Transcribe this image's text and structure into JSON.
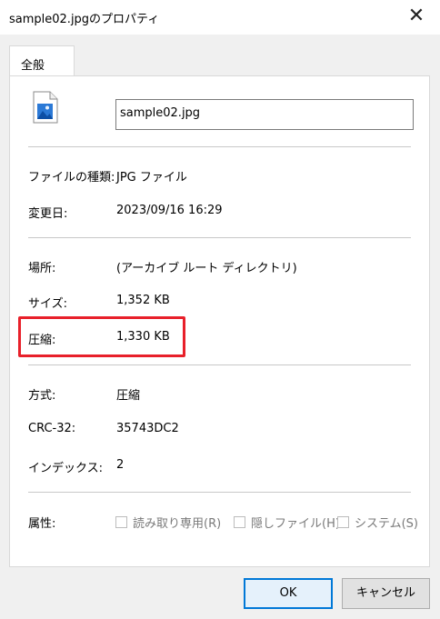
{
  "window": {
    "title": "sample02.jpgのプロパティ",
    "close_glyph": "✕"
  },
  "tabs": [
    {
      "label": "全般",
      "selected": true
    }
  ],
  "file": {
    "name": "sample02.jpg",
    "icon": "image-file-icon"
  },
  "props": {
    "type_label": "ファイルの種類:",
    "type_value": "JPG ファイル",
    "modified_label": "変更日:",
    "modified_value": "2023/09/16 16:29",
    "location_label": "場所:",
    "location_value": "(アーカイブ ルート ディレクトリ)",
    "size_label": "サイズ:",
    "size_value": "1,352 KB",
    "compressed_label": "圧縮:",
    "compressed_value": "1,330 KB",
    "method_label": "方式:",
    "method_value": "圧縮",
    "crc_label": "CRC-32:",
    "crc_value": "35743DC2",
    "index_label": "インデックス:",
    "index_value": "2"
  },
  "attributes": {
    "label": "属性:",
    "readonly": "読み取り専用(R)",
    "hidden": "隠しファイル(H)",
    "system": "システム(S)"
  },
  "buttons": {
    "ok": "OK",
    "cancel": "キャンセル"
  },
  "colors": {
    "highlight": "#e8202a",
    "accent": "#0078d7"
  }
}
